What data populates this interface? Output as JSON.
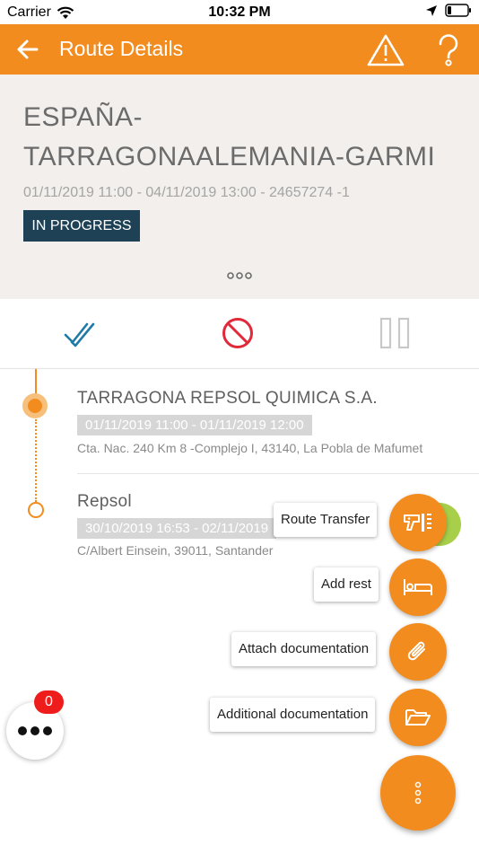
{
  "status_bar": {
    "carrier": "Carrier",
    "time": "10:32 PM",
    "icons": [
      "wifi-icon",
      "location-arrow-icon",
      "battery-icon"
    ]
  },
  "app_bar": {
    "title": "Route Details",
    "background": "#f28c1e",
    "icons": [
      "back-arrow-icon",
      "warning-icon",
      "help-icon"
    ]
  },
  "route": {
    "title": "ESPAÑA-TARRAGONAALEMANIA-GARMI",
    "meta": "01/11/2019 11:00 - 04/11/2019 13:00 - 24657274 -1",
    "status": "IN PROGRESS",
    "status_color": "#1e4156"
  },
  "actions": [
    "check-icon",
    "block-icon",
    "pause-icon"
  ],
  "stops": [
    {
      "name": "TARRAGONA REPSOL QUIMICA S.A.",
      "time_range": "01/11/2019 11:00 - 01/11/2019 12:00",
      "address": "Cta. Nac. 240 Km 8 -Complejo I, 43140, La Pobla de Mafumet",
      "active": true
    },
    {
      "name": "Repsol",
      "time_range": "30/10/2019 16:53 - 02/11/2019",
      "address": "C/Albert Einsein, 39011, Santander",
      "active": false
    }
  ],
  "fab_menu": {
    "items": [
      {
        "label": "Route Transfer",
        "icon": "scanner-icon"
      },
      {
        "label": "Add rest",
        "icon": "bed-icon"
      },
      {
        "label": "Attach documentation",
        "icon": "paperclip-icon"
      },
      {
        "label": "Additional documentation",
        "icon": "folder-open-icon"
      }
    ],
    "main_icon": "vertical-dots-icon"
  },
  "chat": {
    "badge_count": "0",
    "icon": "horizontal-dots-icon"
  }
}
